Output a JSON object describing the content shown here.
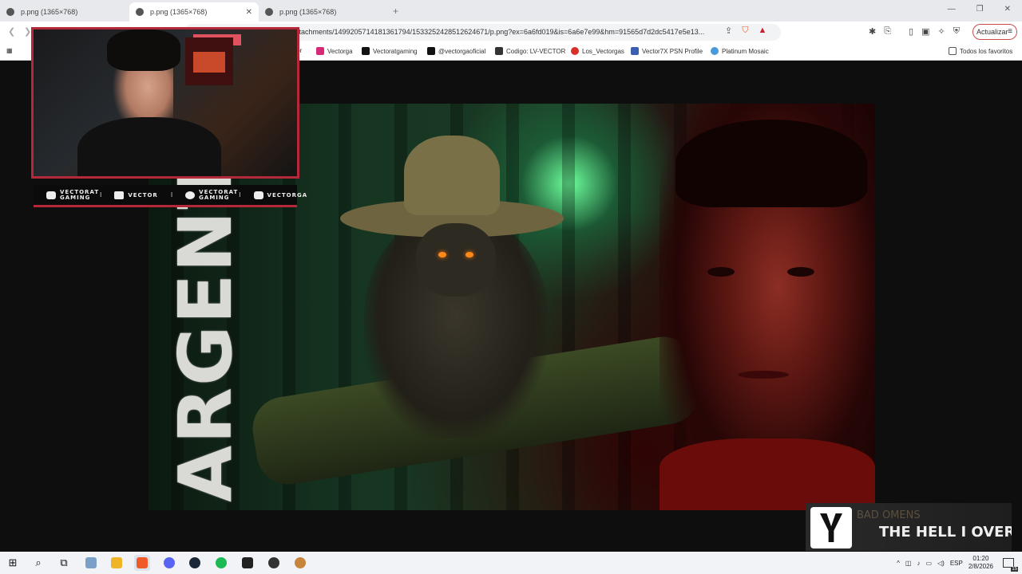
{
  "browser": {
    "tabs": [
      {
        "title": "p.png (1365×768)",
        "active": false
      },
      {
        "title": "p.png (1365×768)",
        "active": true
      },
      {
        "title": "p.png (1365×768)",
        "active": false
      }
    ],
    "url": "ttachments/1499205714181361794/1533252428512624671/p.png?ex=6a6fd019&is=6a6e7e99&hm=91565d7d2dc5417e5e13...",
    "update_label": "Actualizar",
    "bookmarks": [
      {
        "label": "ctor",
        "color": "#888888"
      },
      {
        "label": "Vectorga",
        "color": "#d62976"
      },
      {
        "label": "Vectoratgaming",
        "color": "#111111"
      },
      {
        "label": "@vectorgaoficial",
        "color": "#111111"
      },
      {
        "label": "Codigo: LV-VECTOR",
        "color": "#333333"
      },
      {
        "label": "Los_Vectorgas",
        "color": "#d9302c"
      },
      {
        "label": "Vector7X PSN Profile",
        "color": "#3a5fb0"
      },
      {
        "label": "Platinum Mosaic",
        "color": "#4a9ad9"
      }
    ],
    "favorites_label": "Todos los favoritos"
  },
  "thumbnail": {
    "vertical_text": "ARGENTI"
  },
  "overlay": {
    "social": [
      {
        "icon": "youtube-icon",
        "label": "VECTORAT GAMING"
      },
      {
        "icon": "twitch-icon",
        "label": "VECTOR"
      },
      {
        "icon": "twitter-icon",
        "label": "VECTORAT GAMING"
      },
      {
        "icon": "instagram-icon",
        "label": "VECTORGA"
      }
    ],
    "now_playing": {
      "artist": "BAD OMENS",
      "song": "THE HELL I OVERC"
    }
  },
  "taskbar": {
    "language": "ESP",
    "time": "01:20",
    "date": "2/8/2026",
    "notifications": "15"
  },
  "colors": {
    "accent": "#b5283a"
  }
}
